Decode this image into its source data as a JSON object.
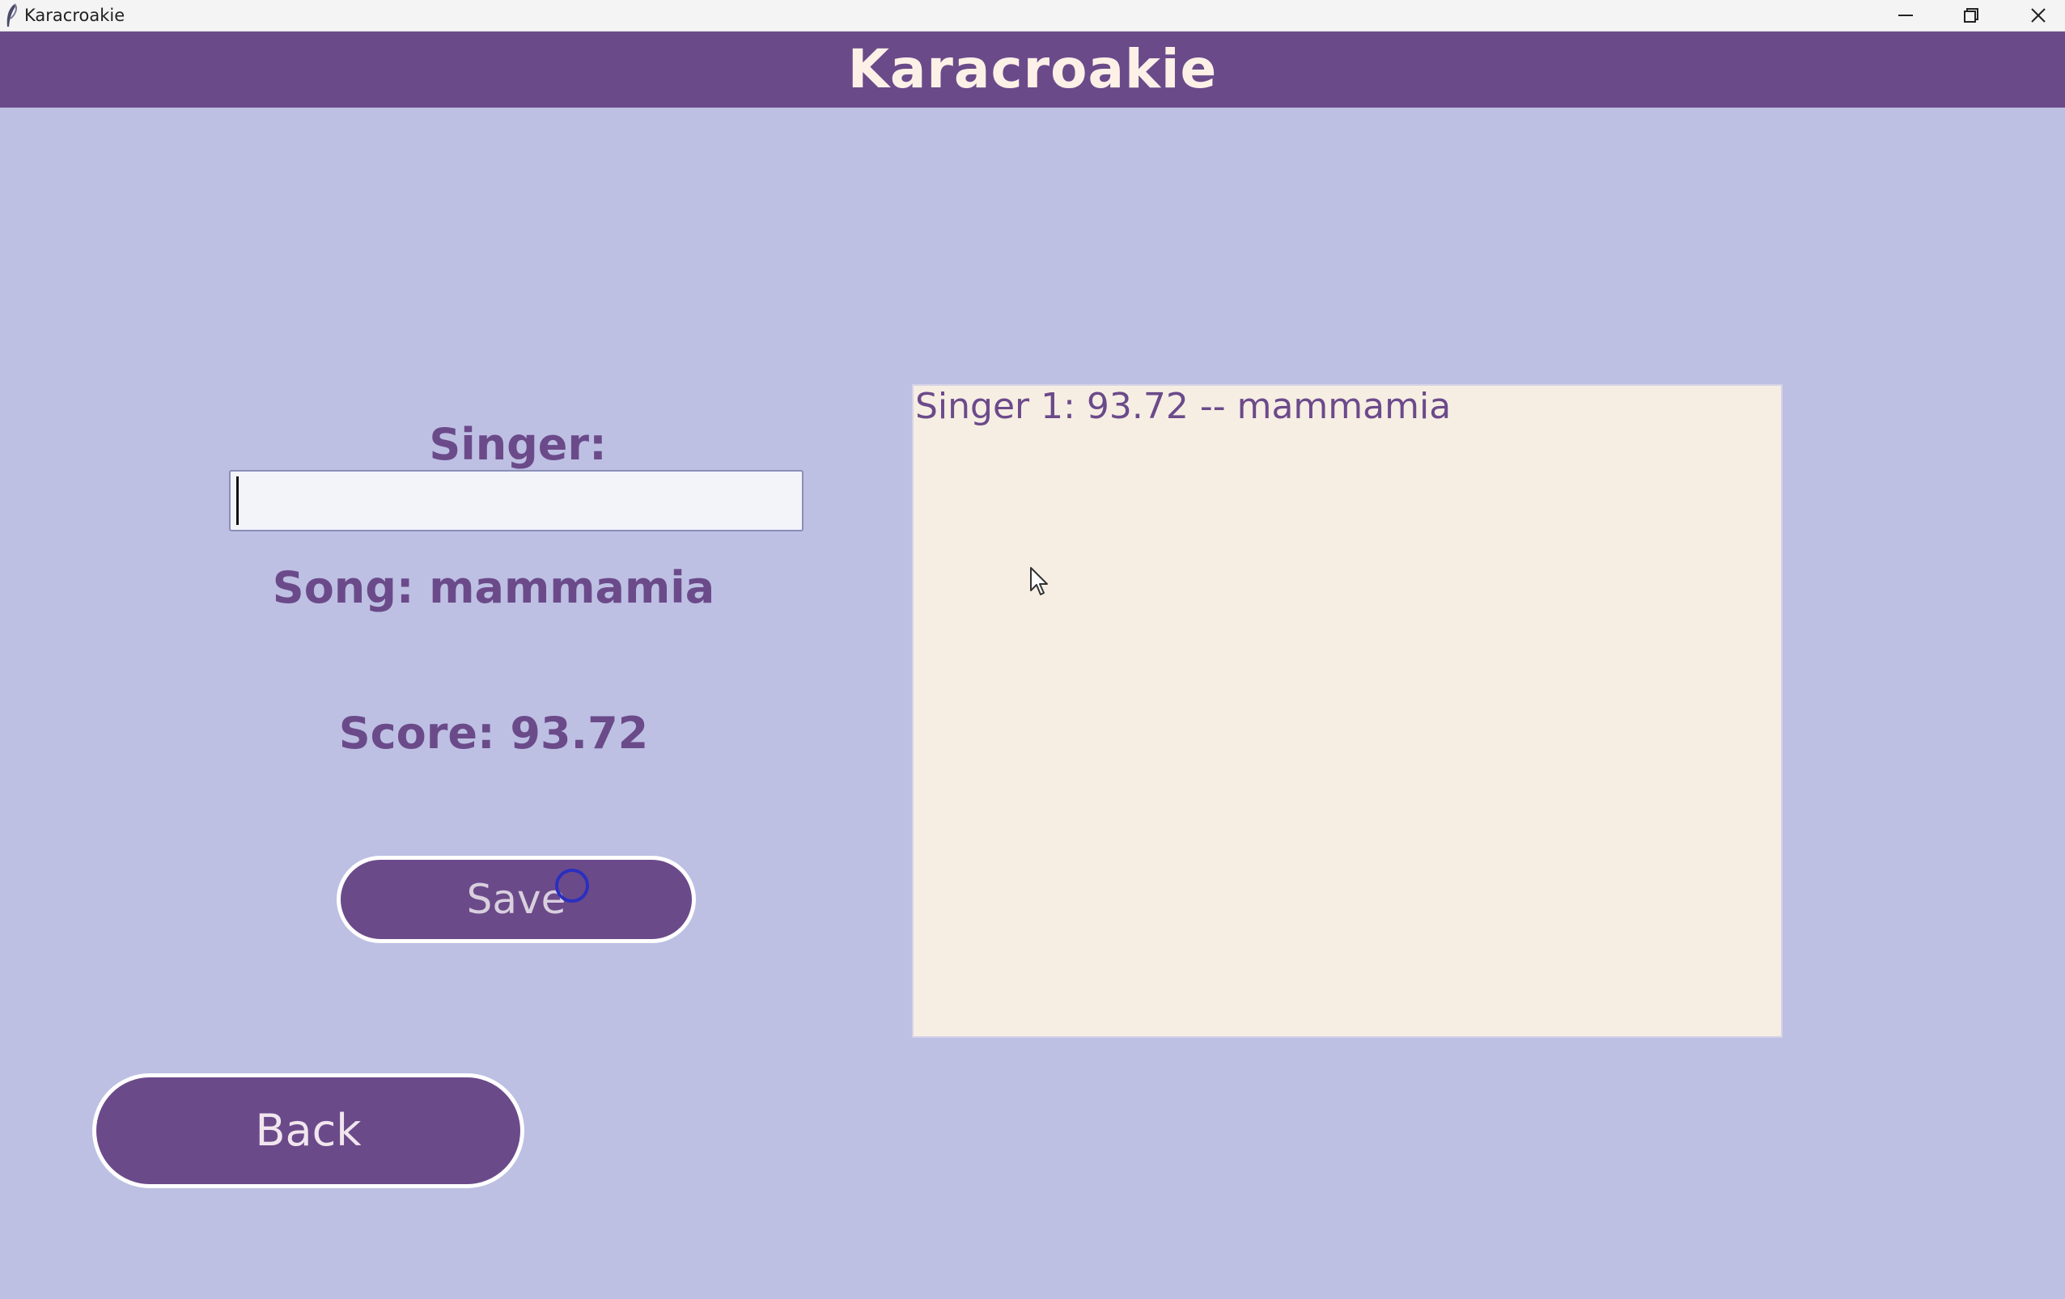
{
  "window": {
    "title": "Karacroakie"
  },
  "header": {
    "title": "Karacroakie",
    "background_color": "#6b4a8a"
  },
  "form": {
    "singer_label": "Singer:",
    "singer_value": "",
    "song_label": "Song: mammamia",
    "score_label": "Score: 93.72",
    "save_label": "Save"
  },
  "results": {
    "lines": [
      "Singer 1: 93.72 -- mammamia"
    ]
  },
  "nav": {
    "back_label": "Back"
  },
  "colors": {
    "accent": "#6b4a8a",
    "background": "#bdc0e3",
    "panel": "#f6eee3",
    "text_light": "#fdf1e7"
  },
  "icons": {
    "app": "feather-icon",
    "minimize": "minimize-icon",
    "restore": "restore-icon",
    "close": "close-icon"
  }
}
